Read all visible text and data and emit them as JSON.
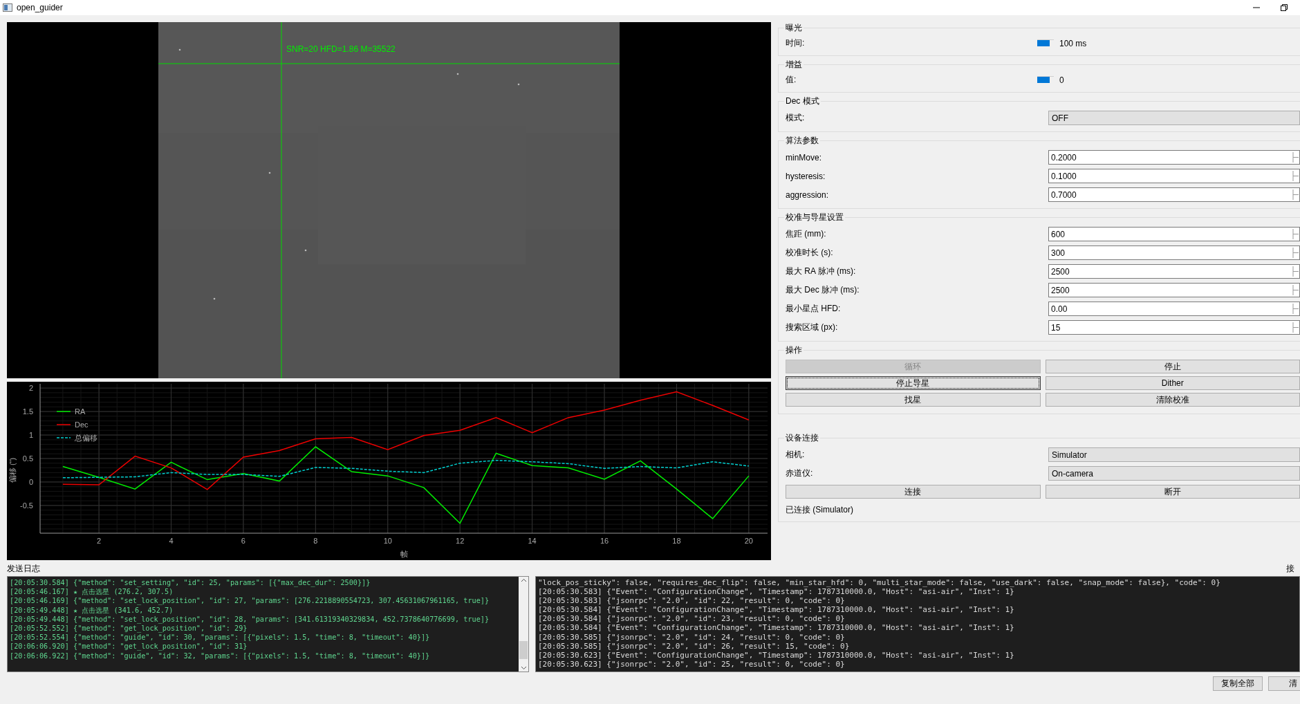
{
  "window": {
    "title": "open_guider"
  },
  "viewer": {
    "kind": "picture",
    "overlay_text": "SNR=20 HFD=1.86 M=35522"
  },
  "chart": {
    "chart_data": {
      "type": "line",
      "xlabel": "帧",
      "ylabel": "偏移 (\")",
      "x": [
        1,
        2,
        3,
        4,
        5,
        6,
        7,
        8,
        9,
        10,
        11,
        12,
        13,
        14,
        15,
        16,
        17,
        18,
        19,
        20
      ],
      "xlim": [
        0.37,
        20.52
      ],
      "ylim": [
        -1.09,
        2.09
      ],
      "grid": true,
      "legend": true,
      "xticks": [
        2,
        4,
        6,
        8,
        10,
        12,
        14,
        16,
        18,
        20
      ],
      "yticks": [
        -0.5,
        0,
        0.5,
        1,
        1.5,
        2
      ],
      "series": [
        {
          "name": "RA",
          "color": "#00ee00",
          "line_style": "solid",
          "values": [
            0.33,
            0.1,
            -0.15,
            0.42,
            0.05,
            0.18,
            0.02,
            0.75,
            0.22,
            0.13,
            -0.12,
            -0.88,
            0.61,
            0.35,
            0.3,
            0.06,
            0.45,
            -0.15,
            -0.78,
            0.13
          ]
        },
        {
          "name": "Dec",
          "color": "#ee0000",
          "line_style": "solid",
          "values": [
            -0.05,
            -0.06,
            0.55,
            0.3,
            -0.16,
            0.53,
            0.67,
            0.92,
            0.95,
            0.69,
            0.99,
            1.1,
            1.37,
            1.05,
            1.37,
            1.53,
            1.74,
            1.92,
            1.63,
            1.32
          ]
        },
        {
          "name": "总偏移",
          "color": "#00d0d0",
          "line_style": "dashed",
          "values": [
            0.09,
            0.1,
            0.11,
            0.2,
            0.16,
            0.16,
            0.12,
            0.31,
            0.29,
            0.23,
            0.2,
            0.4,
            0.46,
            0.43,
            0.39,
            0.29,
            0.33,
            0.3,
            0.43,
            0.34
          ]
        }
      ]
    }
  },
  "settings": {
    "groups": [
      {
        "title": "曝光",
        "rows": [
          {
            "kind": "slider",
            "label": "时间:",
            "level": 0,
            "reading": "100 ms"
          }
        ]
      },
      {
        "title": "增益",
        "rows": [
          {
            "kind": "slider",
            "label": "值:",
            "level": 0,
            "reading": "0"
          }
        ]
      },
      {
        "title": "Dec 模式",
        "rows": [
          {
            "kind": "combo",
            "label": "模式:",
            "value": "OFF"
          }
        ]
      },
      {
        "title": "算法参数",
        "rows": [
          {
            "kind": "spin",
            "label": "minMove:",
            "value": "0.2000"
          },
          {
            "kind": "spin",
            "label": "hysteresis:",
            "value": "0.1000"
          },
          {
            "kind": "spin",
            "label": "aggression:",
            "value": "0.7000"
          }
        ]
      },
      {
        "title": "校准与导星设置",
        "rows": [
          {
            "kind": "spin",
            "label": "焦距 (mm):",
            "value": "600"
          },
          {
            "kind": "spin",
            "label": "校准时长 (s):",
            "value": "300"
          },
          {
            "kind": "spin",
            "label": "最大 RA 脉冲 (ms):",
            "value": "2500"
          },
          {
            "kind": "spin",
            "label": "最大 Dec 脉冲 (ms):",
            "value": "2500"
          },
          {
            "kind": "spin",
            "label": "最小星点 HFD:",
            "value": "0.00"
          },
          {
            "kind": "spin",
            "label": "搜索区域 (px):",
            "value": "15"
          }
        ]
      },
      {
        "title": "操作",
        "rows": [
          {
            "kind": "buttons",
            "buttons": [
              {
                "label": "循环",
                "disabled": true,
                "focused": false
              },
              {
                "label": "停止",
                "disabled": false,
                "focused": false
              }
            ]
          },
          {
            "kind": "buttons",
            "buttons": [
              {
                "label": "停止导星",
                "disabled": false,
                "focused": true
              },
              {
                "label": "Dither",
                "disabled": false,
                "focused": false
              }
            ]
          },
          {
            "kind": "buttons",
            "buttons": [
              {
                "label": "找星",
                "disabled": false,
                "focused": false
              },
              {
                "label": "清除校准",
                "disabled": false,
                "focused": false
              }
            ]
          }
        ]
      },
      {
        "title": "设备连接",
        "rows": [
          {
            "kind": "combo",
            "label": "相机:",
            "value": "Simulator"
          },
          {
            "kind": "combo",
            "label": "赤道仪:",
            "value": "On-camera"
          },
          {
            "kind": "buttons",
            "buttons": [
              {
                "label": "连接",
                "disabled": false,
                "focused": false
              },
              {
                "label": "断开",
                "disabled": false,
                "focused": false
              }
            ]
          },
          {
            "kind": "status",
            "text": "已连接 (Simulator)"
          }
        ]
      }
    ]
  },
  "logs": {
    "send": {
      "title": "发送日志",
      "lines": [
        "[20:05:30.584] {\"method\": \"set_setting\", \"id\": 25, \"params\": [{\"max_dec_dur\": 2500}]}",
        "[20:05:46.167] ★ 点击选星 (276.2, 307.5)",
        "[20:05:46.169] {\"method\": \"set_lock_position\", \"id\": 27, \"params\": [276.2218890554723, 307.45631067961165, true]}",
        "[20:05:49.448] ★ 点击选星 (341.6, 452.7)",
        "[20:05:49.448] {\"method\": \"set_lock_position\", \"id\": 28, \"params\": [341.61319340329834, 452.7378640776699, true]}",
        "[20:05:52.552] {\"method\": \"get_lock_position\", \"id\": 29}",
        "[20:05:52.554] {\"method\": \"guide\", \"id\": 30, \"params\": [{\"pixels\": 1.5, \"time\": 8, \"timeout\": 40}]}",
        "[20:06:06.920] {\"method\": \"get_lock_position\", \"id\": 31}",
        "[20:06:06.922] {\"method\": \"guide\", \"id\": 32, \"params\": [{\"pixels\": 1.5, \"time\": 8, \"timeout\": 40}]}"
      ]
    },
    "receive": {
      "title": "接",
      "lines": [
        "\"lock_pos_sticky\": false, \"requires_dec_flip\": false, \"min_star_hfd\": 0, \"multi_star_mode\": false, \"use_dark\": false, \"snap_mode\": false}, \"code\": 0}",
        "[20:05:30.583] {\"Event\": \"ConfigurationChange\", \"Timestamp\": 1787310000.0, \"Host\": \"asi-air\", \"Inst\": 1}",
        "[20:05:30.583] {\"jsonrpc\": \"2.0\", \"id\": 22, \"result\": 0, \"code\": 0}",
        "[20:05:30.584] {\"Event\": \"ConfigurationChange\", \"Timestamp\": 1787310000.0, \"Host\": \"asi-air\", \"Inst\": 1}",
        "[20:05:30.584] {\"jsonrpc\": \"2.0\", \"id\": 23, \"result\": 0, \"code\": 0}",
        "[20:05:30.584] {\"Event\": \"ConfigurationChange\", \"Timestamp\": 1787310000.0, \"Host\": \"asi-air\", \"Inst\": 1}",
        "[20:05:30.585] {\"jsonrpc\": \"2.0\", \"id\": 24, \"result\": 0, \"code\": 0}",
        "[20:05:30.585] {\"jsonrpc\": \"2.0\", \"id\": 26, \"result\": 15, \"code\": 0}",
        "[20:05:30.623] {\"Event\": \"ConfigurationChange\", \"Timestamp\": 1787310000.0, \"Host\": \"asi-air\", \"Inst\": 1}",
        "[20:05:30.623] {\"jsonrpc\": \"2.0\", \"id\": 25, \"result\": 0, \"code\": 0}"
      ]
    },
    "buttons": [
      "复制全部",
      "清"
    ]
  }
}
